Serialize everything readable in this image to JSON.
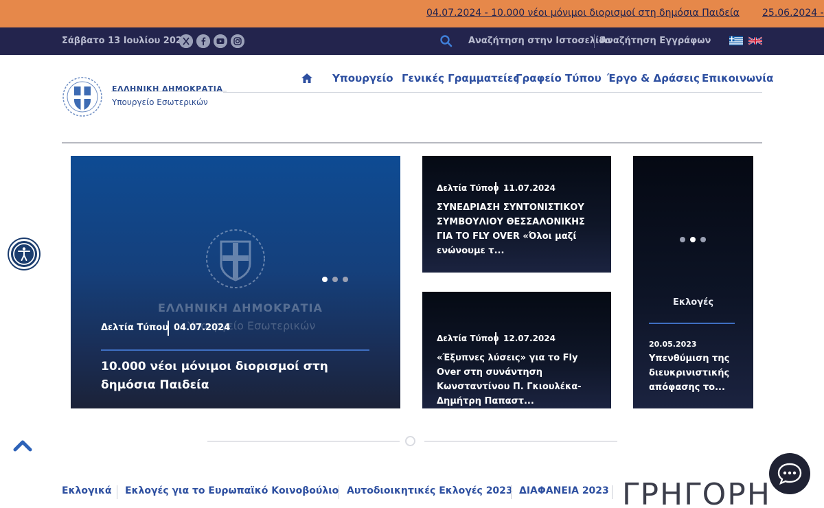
{
  "ticker": {
    "items": [
      "04.07.2024 - 10.000 νέοι μόνιμοι διορισμοί στη δημόσια Παιδεία",
      "25.06.2024 - «"
    ]
  },
  "topbar": {
    "date": "Σάββατο 13 Ιουλίου 2024",
    "social": [
      "x-icon",
      "facebook-icon",
      "youtube-icon",
      "instagram-icon"
    ],
    "search_site": "Αναζήτηση στην Ιστοσελίδα",
    "search_docs": "Αναζήτηση Εγγράφων",
    "languages": [
      "greek-flag-icon",
      "uk-flag-icon"
    ]
  },
  "header": {
    "logo_line1": "ΕΛΛΗΝΙΚΗ ΔΗΜΟΚΡΑΤΙΑ",
    "logo_line2": "Υπουργείο Εσωτερικών",
    "nav": [
      "Υπουργείο",
      "Γενικές Γραμματείες",
      "Γραφείο Τύπου",
      "Έργο & Δράσεις",
      "Επικοινωνία"
    ]
  },
  "cards": {
    "hero": {
      "watermark_line1": "ΕΛΛΗΝΙΚΗ ΔΗΜΟΚΡΑΤΙΑ",
      "watermark_line2": "Υπουργείο Εσωτερικών",
      "category": "Δελτία Τύπου",
      "date": "04.07.2024",
      "title": "10.000 νέοι μόνιμοι διορισμοί στη δημόσια Παιδεία"
    },
    "card2": {
      "category": "Δελτία Τύπου",
      "date": "11.07.2024",
      "title": "ΣΥΝΕΔΡΙΑΣΗ ΣΥΝΤΟΝΙΣΤΙΚΟΥ ΣΥΜΒΟΥΛΙΟΥ ΘΕΣΣΑΛΟΝΙΚΗΣ ΓΙΑ ΤΟ FLY OVER «Όλοι μαζί ενώνουμε τ..."
    },
    "card3": {
      "category": "Δελτία Τύπου",
      "date": "12.07.2024",
      "title": "«Έξυπνες λύσεις» για το Fly Over στη συνάντηση Κωνσταντίνου Π. Γκιουλέκα-Δημήτρη Παπαστ..."
    },
    "card4": {
      "category": "Εκλογές",
      "date": "20.05.2023",
      "title": "Υπενθύμιση της διευκρινιστικής απόφασης το..."
    }
  },
  "bottom": {
    "links": [
      "Εκλογικά",
      "Εκλογές για το Ευρωπαϊκό Κοινοβούλιο",
      "Αυτοδιοικητικές Εκλογές 2023",
      "ΔΙΑΦΑΝΕΙΑ 2023"
    ],
    "big_word": "ΓΡΗΓΟΡΗ"
  },
  "colors": {
    "ticker_bg": "#e6884a",
    "topbar_bg": "#23244d",
    "nav_text": "#2d4fa0",
    "accent_rule": "#3f6fc2"
  }
}
